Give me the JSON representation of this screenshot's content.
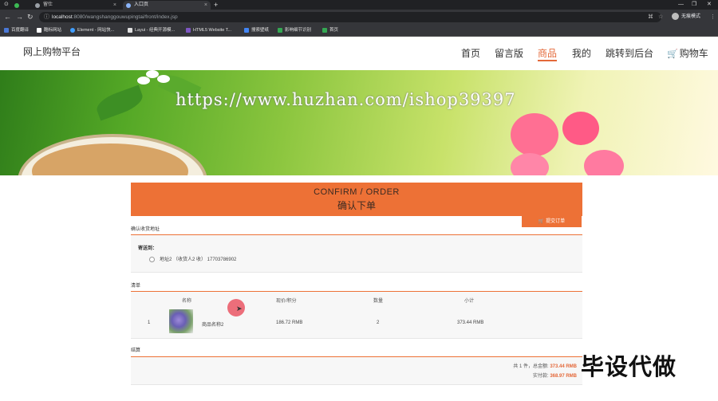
{
  "browser": {
    "tabs": [
      {
        "label": "",
        "active": false
      },
      {
        "label": "留仕",
        "active": false
      },
      {
        "label": "入口页",
        "active": true
      }
    ],
    "url_host": "localhost",
    "url_rest": ":8080/wangshanggouwupingtai/front/index.jsp",
    "profile_label": "无痕模式",
    "bookmarks": [
      "百度翻译",
      "酷标网站",
      "Element - 网站快...",
      "Layui - 经典开源模...",
      "HTML5 Website T...",
      "搜索壁纸",
      "影响细节识别",
      "首页"
    ]
  },
  "site": {
    "brand": "网上购物平台",
    "nav": [
      "首页",
      "留言版",
      "商品",
      "我的",
      "跳转到后台",
      "购物车"
    ]
  },
  "banner_watermark": "https://www.huzhan.com/ishop39397",
  "order": {
    "title_en": "CONFIRM / ORDER",
    "title_cn": "确认下单",
    "address_section_label": "确认收货地址",
    "address_head": "寄送到：",
    "address_line": "地址2 （收货人2 收） 17703786902",
    "list_label": "清单",
    "columns": [
      "名称",
      "现价/积分",
      "数量",
      "小计"
    ],
    "items": [
      {
        "index": "1",
        "name": "商品名称2",
        "price": "186.72 RMB",
        "qty": "2",
        "subtotal": "373.44 RMB"
      }
    ],
    "settle_label": "结算",
    "summary_count_text": "共 1 件，总金额:",
    "summary_total": "373.44 RMB",
    "summary_paid_label": "实付款:",
    "summary_paid": "368.97 RMB",
    "submit_label": "提交订单"
  },
  "overlay_watermark": "毕设代做",
  "colors": {
    "accent": "#ed7136",
    "active_nav": "#e4693a"
  }
}
